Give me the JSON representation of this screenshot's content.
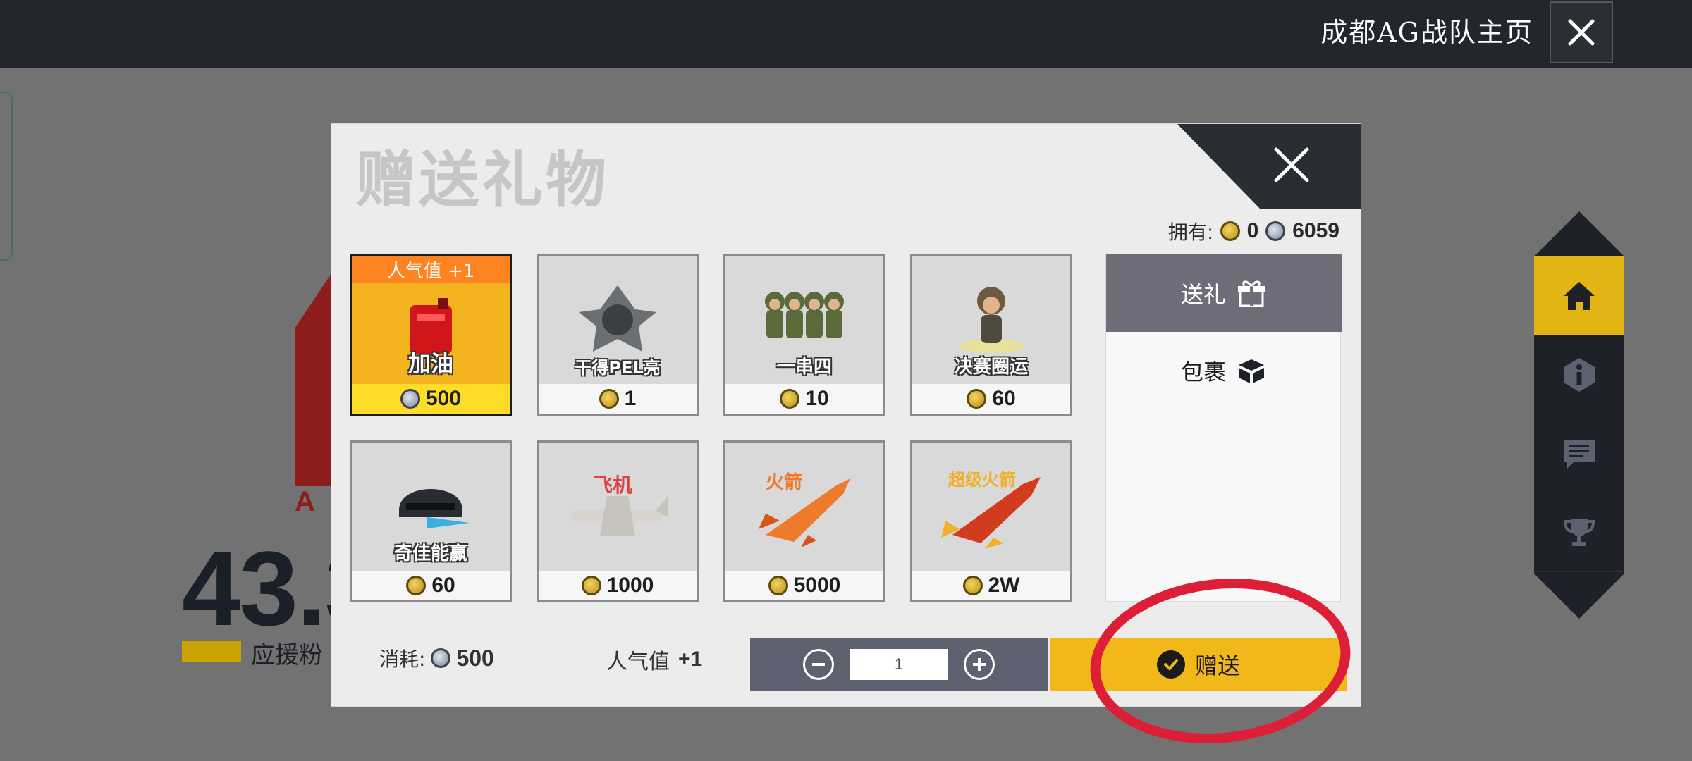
{
  "header": {
    "page_title": "成都AG战队主页"
  },
  "background": {
    "logo_text": "A",
    "stat_value": "43.3",
    "legend_label": "应援粉"
  },
  "side_nav": {
    "items": [
      {
        "icon": "home-icon",
        "active": true
      },
      {
        "icon": "info-icon",
        "active": false
      },
      {
        "icon": "chat-icon",
        "active": false
      },
      {
        "icon": "trophy-icon",
        "active": false
      }
    ]
  },
  "modal": {
    "title": "赠送礼物",
    "owned_label": "拥有:",
    "owned_gold": "0",
    "owned_silver": "6059",
    "gifts": [
      {
        "name": "加油",
        "price": "500",
        "coin": "silver",
        "badge": "人气值 +1",
        "selected": true,
        "colors": {
          "art": "#d0161b"
        }
      },
      {
        "name": "干得PEL亮",
        "price": "1",
        "coin": "gold",
        "selected": false,
        "colors": {
          "art": "#4a6a56"
        }
      },
      {
        "name": "一串四",
        "price": "10",
        "coin": "gold",
        "selected": false,
        "colors": {
          "art": "#5a6a3a"
        }
      },
      {
        "name": "决赛圈运",
        "price": "60",
        "coin": "gold",
        "selected": false,
        "colors": {
          "art": "#6c5a43"
        }
      },
      {
        "name": "奇佳能赢",
        "price": "60",
        "coin": "gold",
        "selected": false,
        "colors": {
          "art": "#2a2c33"
        }
      },
      {
        "name": "飞机",
        "price": "1000",
        "coin": "gold",
        "selected": false,
        "colors": {
          "art": "#cfcfcf"
        }
      },
      {
        "name": "火箭",
        "price": "5000",
        "coin": "gold",
        "selected": false,
        "colors": {
          "art": "#ee7b2b"
        }
      },
      {
        "name": "超级火箭",
        "price": "2W",
        "coin": "gold",
        "selected": false,
        "colors": {
          "art": "#d13b1e"
        }
      }
    ],
    "tabs": [
      {
        "label": "送礼",
        "icon": "gift-icon",
        "active": true
      },
      {
        "label": "包裹",
        "icon": "box-icon",
        "active": false
      }
    ],
    "cost_label": "消耗:",
    "cost_value": "500",
    "popularity_label": "人气值",
    "popularity_value": "+1",
    "quantity_value": "1",
    "send_label": "赠送"
  },
  "colors": {
    "accent": "#f2b718",
    "selected_card": "#f4b41f",
    "annotation": "#dc1e37"
  }
}
